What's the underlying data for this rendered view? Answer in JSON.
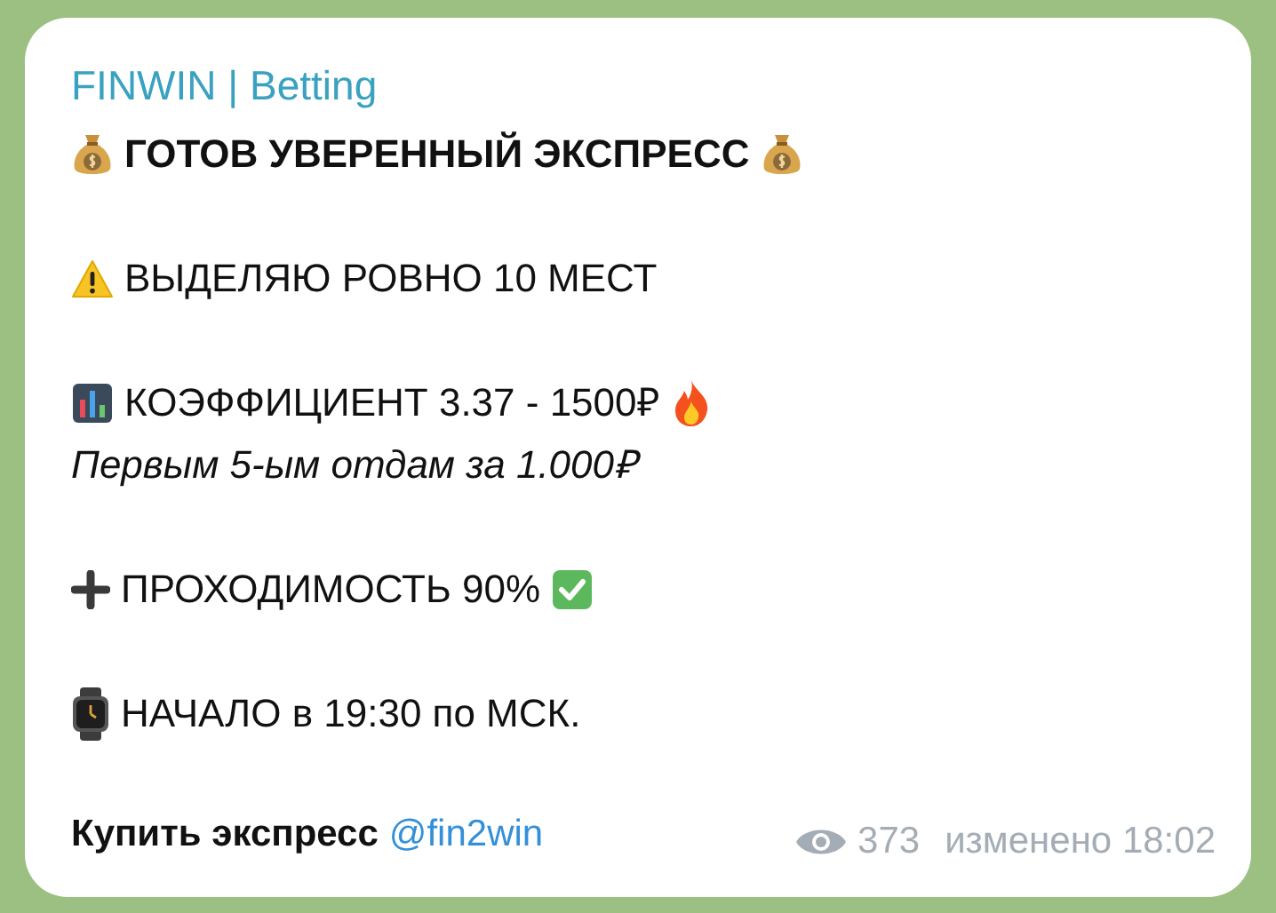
{
  "message": {
    "sender": "FINWIN | Betting",
    "paragraphs": [
      {
        "lines": [
          {
            "kind": "bold",
            "text": "ГОТОВ УВЕРЕННЫЙ ЭКСПРЕСС"
          }
        ]
      },
      {
        "lines": [
          {
            "kind": "plain",
            "text": "ВЫДЕЛЯЮ РОВНО 10 МЕСТ"
          }
        ]
      },
      {
        "lines": [
          {
            "kind": "plain",
            "text": "КОЭФФИЦИЕНТ 3.37 - 1500₽"
          },
          {
            "kind": "italic",
            "text": "Первым 5-ым отдам за 1.000₽"
          }
        ]
      },
      {
        "lines": [
          {
            "kind": "plain",
            "text": "ПРОХОДИМОСТЬ 90%"
          }
        ]
      },
      {
        "lines": [
          {
            "kind": "plain",
            "text": "НАЧАЛО в 19:30 по МСК."
          }
        ]
      }
    ],
    "footer": {
      "label": "Купить экспресс",
      "link": "@fin2win"
    },
    "views": "373",
    "edited": "изменено 18:02"
  }
}
